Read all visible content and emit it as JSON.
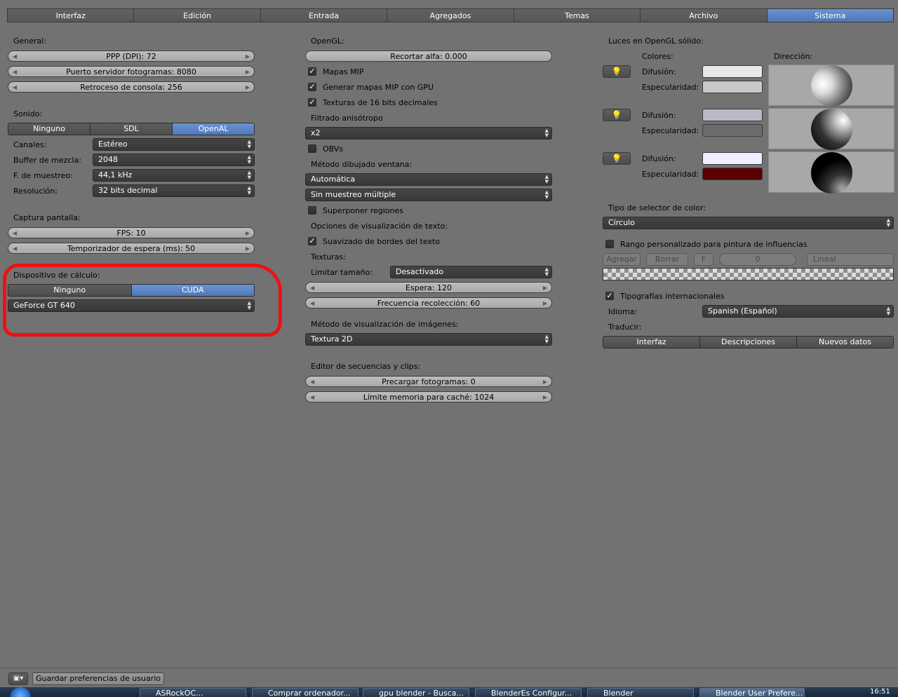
{
  "tabs": [
    "Interfaz",
    "Edición",
    "Entrada",
    "Agregados",
    "Temas",
    "Archivo",
    "Sistema"
  ],
  "active_tab": "Sistema",
  "general": {
    "title": "General:",
    "dpi": "PPP (DPI): 72",
    "frame_server_port": "Puerto servidor fotogramas: 8080",
    "console_scrollback": "Retroceso de consola: 256"
  },
  "sound": {
    "title": "Sonido:",
    "options": [
      "Ninguno",
      "SDL",
      "OpenAL"
    ],
    "selected": "OpenAL",
    "channels_label": "Canales:",
    "channels_value": "Estéreo",
    "mix_buffer_label": "Buffer de mezcla:",
    "mix_buffer_value": "2048",
    "sample_rate_label": "F. de muestreo:",
    "sample_rate_value": "44,1 kHz",
    "resolution_label": "Resolución:",
    "resolution_value": "32 bits decimal"
  },
  "screencast": {
    "title": "Captura pantalla:",
    "fps": "FPS: 10",
    "wait_timer": "Temporizador de espera (ms): 50"
  },
  "compute": {
    "title": "Dispositivo de cálculo:",
    "options": [
      "Ninguno",
      "CUDA"
    ],
    "selected": "CUDA",
    "device": "GeForce GT 640"
  },
  "opengl": {
    "title": "OpenGL:",
    "clip_alpha": "Recortar alfa: 0.000",
    "mipmaps": "Mapas MIP",
    "gpu_mipmaps": "Generar mapas MIP con GPU",
    "float_textures": "Texturas de 16 bits decimales",
    "anisotropic_label": "Filtrado anisótropo",
    "anisotropic_value": "x2",
    "vbos": "OBVs",
    "window_draw_label": "Método dibujado ventana:",
    "window_draw_value": "Automática",
    "multisample_value": "Sin muestreo múltiple",
    "region_overlap": "Superponer regiones",
    "text_options_label": "Opciones de visualización de texto:",
    "text_antialiasing": "Suavizado de bordes del texto",
    "textures_label": "Texturas:",
    "limit_size_label": "Limitar tamaño:",
    "limit_size_value": "Desactivado",
    "time_out": "Espera: 120",
    "collection_rate": "Frecuencia recolección: 60",
    "image_draw_label": "Método de visualización de imágenes:",
    "image_draw_value": "Textura 2D",
    "sequencer_label": "Editor de secuencias y clips:",
    "prefetch_frames": "Precargar fotogramas: 0",
    "memory_cache_limit": "Límite memoria para caché: 1024"
  },
  "solid_lights": {
    "title": "Luces en OpenGL sólido:",
    "colors_label": "Colores:",
    "direction_label": "Dirección:",
    "diffuse_label": "Difusión:",
    "specular_label": "Especularidad:",
    "lights": [
      {
        "diffuse": "#e8e8e8",
        "specular": "#c8c8c8"
      },
      {
        "diffuse": "#b9b9c8",
        "specular": "#6c6c6c"
      },
      {
        "diffuse": "#eeeeff",
        "specular": "#5a0000"
      }
    ]
  },
  "color_picker": {
    "label": "Tipo de selector de color:",
    "value": "Círculo"
  },
  "weight_range": {
    "label": "Rango personalizado para pintura de influencias",
    "add": "Agregar",
    "delete": "Borrar",
    "f": "F",
    "position": "0",
    "interp": "Lineal"
  },
  "international": {
    "label": "Tipografías internacionales",
    "language_label": "Idioma:",
    "language_value": "Spanish (Español)",
    "translate_label": "Traducir:",
    "translate_options": [
      "Interfaz",
      "Descripciones",
      "Nuevos datos"
    ]
  },
  "footer": {
    "save_button": "Guardar preferencias de usuario"
  },
  "taskbar": {
    "items": [
      "ASRockOC...",
      "Comprar ordenador...",
      "gpu blender - Busca...",
      "BlenderEs Configur...",
      "Blender",
      "Blender User Prefere..."
    ],
    "clock": "16:51"
  },
  "colors": {
    "background": "#727272",
    "active_blue": "#5a83c4",
    "highlight_red": "#ee1111"
  }
}
